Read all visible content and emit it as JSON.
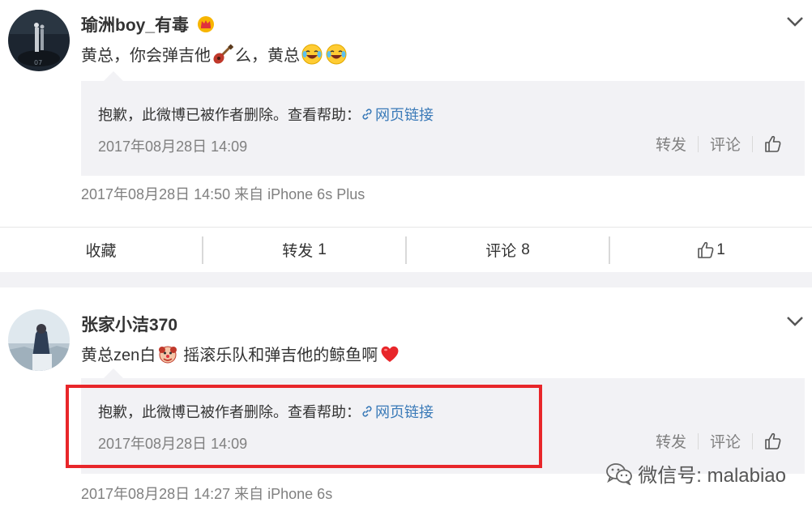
{
  "posts": [
    {
      "username": "瑜洲boy_有毒",
      "content_before": "黄总，你会弹吉他",
      "content_middle": "么，黄总",
      "content_after": "",
      "repost": {
        "deleted_text": "抱歉，此微博已被作者删除。查看帮助：",
        "link_label": "网页链接",
        "time": "2017年08月28日 14:09",
        "forward_label": "转发",
        "comment_label": "评论"
      },
      "meta": "2017年08月28日 14:50 来自 iPhone 6s Plus"
    },
    {
      "username": "张家小洁370",
      "content_before": "黄总zen白",
      "content_middle": "摇滚乐队和弹吉他的鲸鱼啊",
      "content_after": "",
      "repost": {
        "deleted_text": "抱歉，此微博已被作者删除。查看帮助：",
        "link_label": "网页链接",
        "time": "2017年08月28日 14:09",
        "forward_label": "转发",
        "comment_label": "评论"
      },
      "meta": "2017年08月28日 14:27 来自 iPhone 6s"
    }
  ],
  "action_bar": {
    "favorite_label": "收藏",
    "forward_label": "转发",
    "forward_count": "1",
    "comment_label": "评论",
    "comment_count": "8",
    "like_count": "1"
  },
  "watermark": {
    "text": "微信号: malabiao"
  },
  "icons": {
    "crown": "crown-icon",
    "guitar": "guitar-emoji-icon",
    "laugh": "laugh-cry-emoji-icon",
    "clown": "clown-emoji-icon",
    "heart": "heart-emoji-icon",
    "link": "link-icon",
    "like": "thumbs-up-icon",
    "chevron": "chevron-down-icon",
    "wechat": "wechat-icon"
  },
  "colors": {
    "link": "#3a7ab8",
    "highlight_border": "#e8262a",
    "repost_bg": "#f2f2f5",
    "muted_text": "#808080"
  }
}
